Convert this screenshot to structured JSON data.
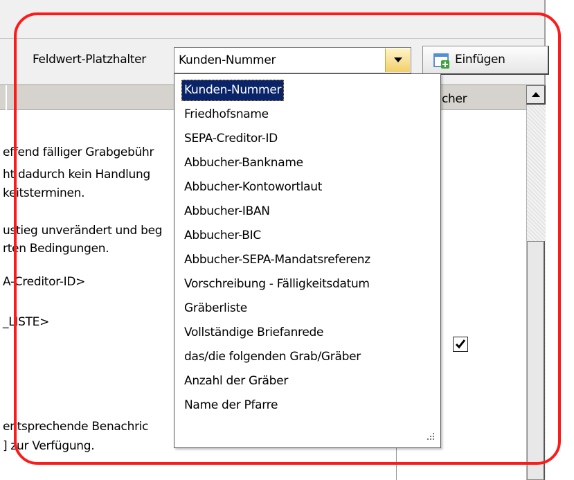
{
  "toolbar": {
    "placeholder_label": "Feldwert-Platzhalter",
    "combo_value": "Kunden-Nummer",
    "insert_button_label": "Einfügen"
  },
  "grid": {
    "header_right_label": "cher",
    "lines": [
      "effend fälliger Grabgebühr",
      "ht dadurch kein Handlung",
      "keitsterminen.",
      "ustieg unverändert und beg",
      "rten Bedingungen.",
      "A-Creditor-ID>",
      "_LISTE>",
      "entsprechende Benachric",
      "] zur Verfügung."
    ],
    "checkbox_checked": true
  },
  "dropdown": {
    "selected_index": 0,
    "options": [
      "Kunden-Nummer",
      "Friedhofsname",
      "SEPA-Creditor-ID",
      "Abbucher-Bankname",
      "Abbucher-Kontowortlaut",
      "Abbucher-IBAN",
      "Abbucher-BIC",
      "Abbucher-SEPA-Mandatsreferenz",
      "Vorschreibung - Fälligkeitsdatum",
      "Gräberliste",
      "Vollständige Briefanrede",
      "das/die folgenden Grab/Gräber",
      "Anzahl der Gräber",
      "Name der Pfarre"
    ]
  },
  "colors": {
    "annotation": "#ff1a1a",
    "selection": "#0a246a"
  },
  "icons": {
    "combo_arrow": "chevron-down-icon",
    "insert": "insert-field-icon",
    "scroll_up": "arrow-up-icon",
    "resize": "resize-grip-icon"
  }
}
